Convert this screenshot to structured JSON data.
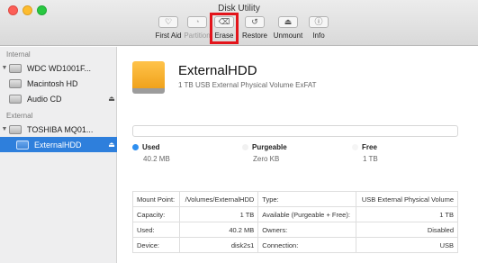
{
  "window": {
    "title": "Disk Utility"
  },
  "toolbar": {
    "buttons": [
      {
        "label": "First Aid",
        "icon": "stethoscope-icon",
        "glyph": "♡",
        "enabled": true
      },
      {
        "label": "Partition",
        "icon": "partition-icon",
        "glyph": "◔",
        "enabled": false
      },
      {
        "label": "Erase",
        "icon": "erase-icon",
        "glyph": "⌫",
        "enabled": true,
        "highlighted": true
      },
      {
        "label": "Restore",
        "icon": "restore-icon",
        "glyph": "↺",
        "enabled": true
      },
      {
        "label": "Unmount",
        "icon": "unmount-icon",
        "glyph": "⏏",
        "enabled": true
      },
      {
        "label": "Info",
        "icon": "info-icon",
        "glyph": "ⓘ",
        "enabled": true
      }
    ],
    "highlight_color": "#e3141b"
  },
  "sidebar": {
    "internal_header": "Internal",
    "external_header": "External",
    "items": [
      {
        "label": "WDC WD1001F...",
        "type": "disk",
        "expanded": true
      },
      {
        "label": "Macintosh HD",
        "type": "volume"
      },
      {
        "label": "Audio CD",
        "type": "disk",
        "eject": "⏏"
      },
      {
        "label": "TOSHIBA MQ01...",
        "type": "disk",
        "expanded": true
      },
      {
        "label": "ExternalHDD",
        "type": "volume",
        "selected": true,
        "eject": "⏏"
      }
    ],
    "selection_color": "#2e7fdc"
  },
  "volume": {
    "name": "ExternalHDD",
    "description": "1 TB USB External Physical Volume ExFAT"
  },
  "usage": {
    "used": {
      "label": "Used",
      "value": "40.2 MB",
      "color": "#2e8ff0"
    },
    "purgeable": {
      "label": "Purgeable",
      "value": "Zero KB",
      "color": "#f1f1f1"
    },
    "free": {
      "label": "Free",
      "value": "1 TB",
      "color": "#f5f5f5"
    }
  },
  "info": {
    "rows": [
      [
        "Mount Point:",
        "/Volumes/ExternalHDD",
        "Type:",
        "USB External Physical Volume"
      ],
      [
        "Capacity:",
        "1 TB",
        "Available (Purgeable + Free):",
        "1 TB"
      ],
      [
        "Used:",
        "40.2 MB",
        "Owners:",
        "Disabled"
      ],
      [
        "Device:",
        "disk2s1",
        "Connection:",
        "USB"
      ]
    ]
  }
}
